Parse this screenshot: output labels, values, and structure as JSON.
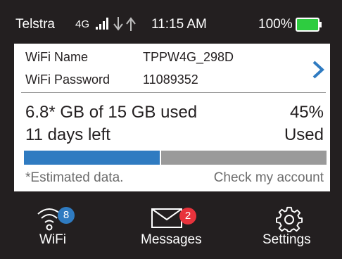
{
  "status_bar": {
    "carrier": "Telstra",
    "network": "4G",
    "time": "11:15 AM",
    "battery": "100%",
    "battery_color": "#2ecc40"
  },
  "wifi": {
    "name_label": "WiFi Name",
    "name_value": "TPPW4G_298D",
    "password_label": "WiFi Password",
    "password_value": "11089352"
  },
  "usage": {
    "used_text": "6.8* GB of 15 GB used",
    "days_left": "11 days left",
    "percent": "45%",
    "percent_label": "Used",
    "used_fraction": 0.45,
    "bar_used_color": "#2f7bc1",
    "bar_remaining_color": "#9a9a9a",
    "estimate_note": "*Estimated data.",
    "account_link": "Check my account"
  },
  "nav": {
    "wifi": {
      "label": "WiFi",
      "badge": "8",
      "badge_color": "#2f7bc1"
    },
    "messages": {
      "label": "Messages",
      "badge": "2",
      "badge_color": "#e8333c"
    },
    "settings": {
      "label": "Settings"
    }
  },
  "icons": [
    "signal-bars-icon",
    "data-arrows-icon",
    "battery-icon",
    "chevron-right-icon",
    "wifi-icon",
    "envelope-icon",
    "gear-icon"
  ]
}
